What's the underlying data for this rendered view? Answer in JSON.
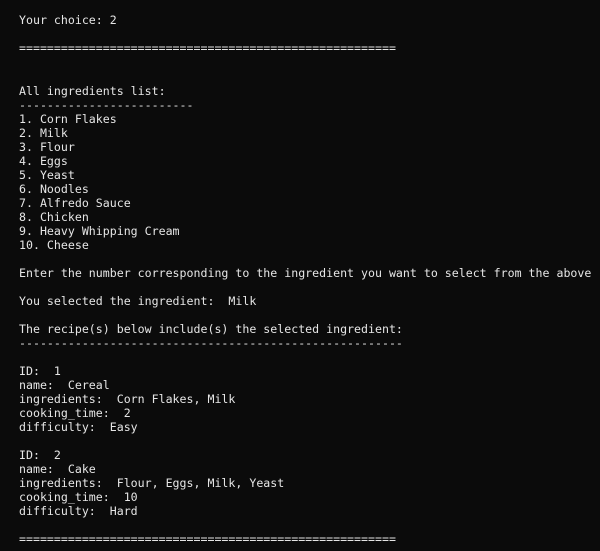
{
  "terminal": {
    "lines": [
      "Your choice: 2",
      "======================================================",
      "All ingredients list:",
      "-------------------------",
      "1. Corn Flakes",
      "2. Milk",
      "3. Flour",
      "4. Eggs",
      "5. Yeast",
      "6. Noodles",
      "7. Alfredo Sauce",
      "8. Chicken",
      "9. Heavy Whipping Cream",
      "10. Cheese",
      "Enter the number corresponding to the ingredient you want to select from the above",
      "You selected the ingredient:  Milk",
      "The recipe(s) below include(s) the selected ingredient:",
      "-------------------------------------------------------",
      "ID:  1",
      "name:  Cereal",
      "ingredients:  Corn Flakes, Milk",
      "cooking_time:  2",
      "difficulty:  Easy",
      "ID:  2",
      "name:  Cake",
      "ingredients:  Flour, Eggs, Milk, Yeast",
      "cooking_time:  10",
      "difficulty:  Hard",
      "======================================================"
    ]
  },
  "colors": {
    "background": "#0b0b0b",
    "text": "#e6e6e6"
  }
}
